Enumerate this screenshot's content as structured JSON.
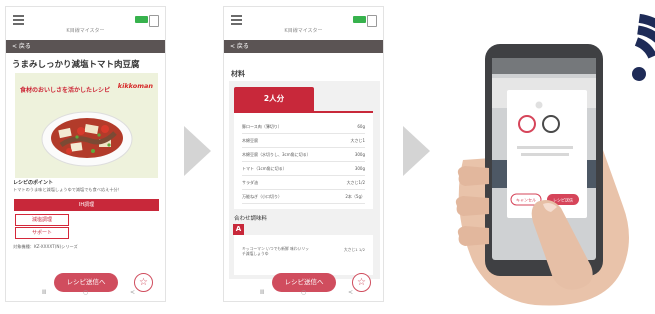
{
  "screen1": {
    "app_title": "K目線マイスター",
    "back_label": "< 戻る",
    "recipe_title": "うまみしっかり減塩トマト肉豆腐",
    "promo_text": "食材のおいしさを活かしたレシピ",
    "brand": "kikkoman",
    "point_label": "レシピのポイント",
    "point_text": "トマトのうま味と減塩しょうゆで減塩でも食べ応え十分！",
    "red_bar_label": "IH調理",
    "reduce_salt_label": "減塩調理",
    "support_label": "サポート",
    "model_text": "対象機種：KZ-XXXXT(N)シリーズ",
    "send_label": "レシピ送信へ",
    "star_icon": "☆",
    "nav": {
      "recent": "Ⅲ",
      "home": "○",
      "back": "<"
    }
  },
  "screen2": {
    "app_title": "K目線マイスター",
    "back_label": "< 戻る",
    "section_label": "材料",
    "portion_tab": "2人分",
    "ingredients": [
      {
        "name": "豚ロース肉（薄切り）",
        "qty": "60g"
      },
      {
        "name": "木綿豆腐",
        "qty": "大さじ1"
      },
      {
        "name": "木綿豆腐（水切りし、3cm角に切る）",
        "qty": "300g"
      },
      {
        "name": "トマト（1cm角に切る）",
        "qty": "300g"
      },
      {
        "name": "サラダ油",
        "qty": "大さじ1/2"
      },
      {
        "name": "万能ねぎ（小口切り）",
        "qty": "2本（5g）"
      }
    ],
    "mix_label": "合わせ調味料",
    "badge_a": "A",
    "sauce_item": "キッコーマン いつでも新鮮 味わいリッチ減塩しょうゆ",
    "sauce_qty": "大さじ1 1/2",
    "send_label": "レシピ送信へ",
    "star_icon": "☆",
    "nav": {
      "recent": "Ⅲ",
      "home": "○",
      "back": "<"
    }
  },
  "screen3": {
    "cancel_label": "キャンセル",
    "send_label": "レシピ送信"
  },
  "colors": {
    "accent_red": "#c8283a",
    "send_pink": "#d04d5e",
    "wifi_navy": "#1e2b57",
    "back_bar": "#5b5454"
  }
}
